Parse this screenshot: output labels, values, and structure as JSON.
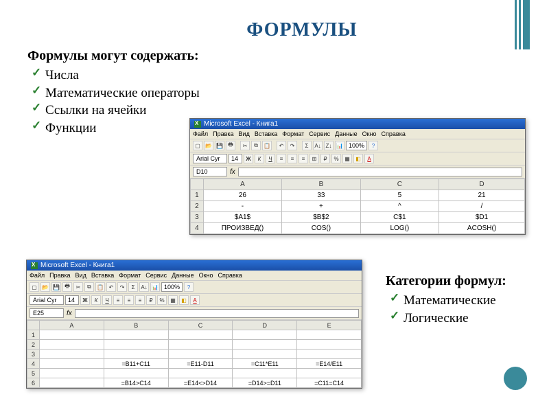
{
  "slide": {
    "title": "ФОРМУЛЫ",
    "intro": "Формулы могут содержать:",
    "bullets": [
      "Числа",
      "Математические операторы",
      "Ссылки на ячейки",
      "Функции"
    ],
    "categories_heading": "Категории формул:",
    "categories": [
      "Математические",
      "Логические"
    ]
  },
  "excel_common": {
    "app_title": "Microsoft Excel - Книга1",
    "menu": [
      "Файл",
      "Правка",
      "Вид",
      "Вставка",
      "Формат",
      "Сервис",
      "Данные",
      "Окно",
      "Справка"
    ],
    "font_name": "Arial Cyr",
    "font_size": "14",
    "zoom": "100%"
  },
  "excel1": {
    "namebox": "D10",
    "columns": [
      "A",
      "B",
      "C",
      "D"
    ],
    "rows": [
      {
        "n": "1",
        "cells": [
          "26",
          "33",
          "5",
          "21"
        ]
      },
      {
        "n": "2",
        "cells": [
          "-",
          "+",
          "^",
          "/"
        ]
      },
      {
        "n": "3",
        "cells": [
          "$A1$",
          "$B$2",
          "C$1",
          "$D1"
        ]
      },
      {
        "n": "4",
        "cells": [
          "ПРОИЗВЕД()",
          "COS()",
          "LOG()",
          "ACOSH()"
        ]
      }
    ]
  },
  "excel2": {
    "namebox": "E25",
    "columns": [
      "A",
      "B",
      "C",
      "D",
      "E"
    ],
    "rows": [
      {
        "n": "1",
        "cells": [
          "",
          "",
          "",
          "",
          ""
        ]
      },
      {
        "n": "2",
        "cells": [
          "",
          "",
          "",
          "",
          ""
        ]
      },
      {
        "n": "3",
        "cells": [
          "",
          "",
          "",
          "",
          ""
        ]
      },
      {
        "n": "4",
        "cells": [
          "",
          "=B11+C11",
          "=E11-D11",
          "=C11*E11",
          "=E14/E11"
        ]
      },
      {
        "n": "5",
        "cells": [
          "",
          "",
          "",
          "",
          ""
        ]
      },
      {
        "n": "6",
        "cells": [
          "",
          "=B14>C14",
          "=E14<>D14",
          "=D14>=D11",
          "=C11=C14"
        ]
      }
    ]
  }
}
